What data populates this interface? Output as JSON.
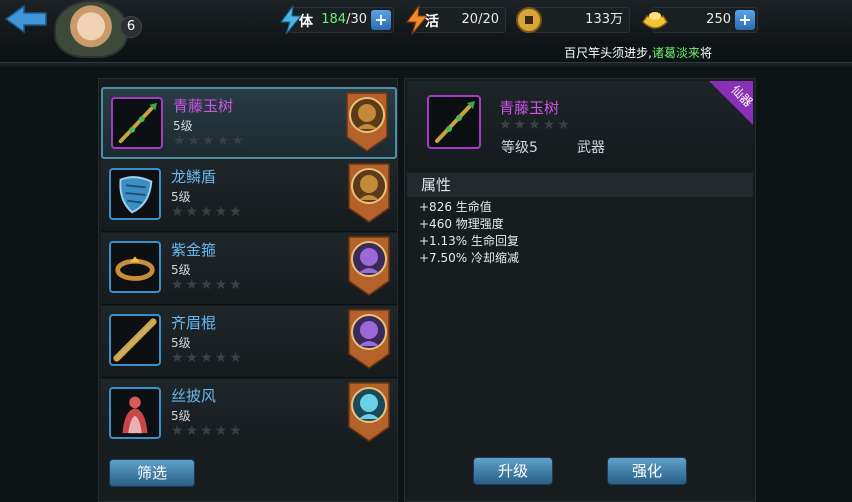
{
  "header": {
    "level": "6",
    "stamina": {
      "label": "体",
      "current": "184",
      "max": "/30"
    },
    "vitality": {
      "label": "活",
      "value": "20/20"
    },
    "coins": "133万",
    "ingots": "250",
    "hint": {
      "prefix": "百尺竿头须进步,",
      "highlight": "诸葛淡来",
      "suffix": "将"
    }
  },
  "items": [
    {
      "name": "青藤玉树",
      "level": "5级",
      "quality": "purple",
      "icon": "jade-staff-icon",
      "hero": "hero-brown"
    },
    {
      "name": "龙鳞盾",
      "level": "5级",
      "quality": "blue",
      "icon": "dragon-shield-icon",
      "hero": "hero-brown"
    },
    {
      "name": "紫金箍",
      "level": "5级",
      "quality": "blue",
      "icon": "gold-ring-icon",
      "hero": "hero-purple"
    },
    {
      "name": "齐眉棍",
      "level": "5级",
      "quality": "blue",
      "icon": "golden-cudgel-icon",
      "hero": "hero-purple"
    },
    {
      "name": "丝披风",
      "level": "5级",
      "quality": "blue",
      "icon": "silk-cape-icon",
      "hero": "hero-cyan"
    }
  ],
  "stars_text": "★★★★★",
  "filter_label": "筛选",
  "detail": {
    "name": "青藤玉树",
    "grade": "等级5",
    "type": "武器",
    "tag": "仙器",
    "attr_title": "属性",
    "attrs": [
      "+826 生命值",
      "+460 物理强度",
      "+1.13% 生命回复",
      "+7.50% 冷却缩减"
    ]
  },
  "actions": {
    "upgrade": "升级",
    "enhance": "强化"
  },
  "colors": {
    "purple": "#cc55e6",
    "blue": "#68b8f0",
    "accent": "#4e8fa6"
  }
}
